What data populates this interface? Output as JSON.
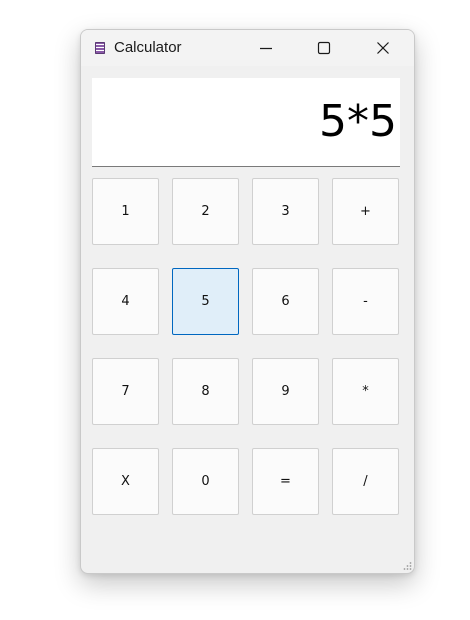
{
  "window": {
    "title": "Calculator",
    "controls": {
      "minimize": "minimize-icon",
      "maximize": "maximize-icon",
      "close": "close-icon"
    }
  },
  "display": {
    "expression": "5*5"
  },
  "keypad": {
    "rows": [
      [
        "1",
        "2",
        "3",
        "+"
      ],
      [
        "4",
        "5",
        "6",
        "-"
      ],
      [
        "7",
        "8",
        "9",
        "*"
      ],
      [
        "X",
        "0",
        "=",
        "/"
      ]
    ],
    "focused_key": "5"
  },
  "colors": {
    "focus_border": "#0067c0",
    "focus_fill": "#e0eef9",
    "app_icon": "#8a5aa8"
  }
}
